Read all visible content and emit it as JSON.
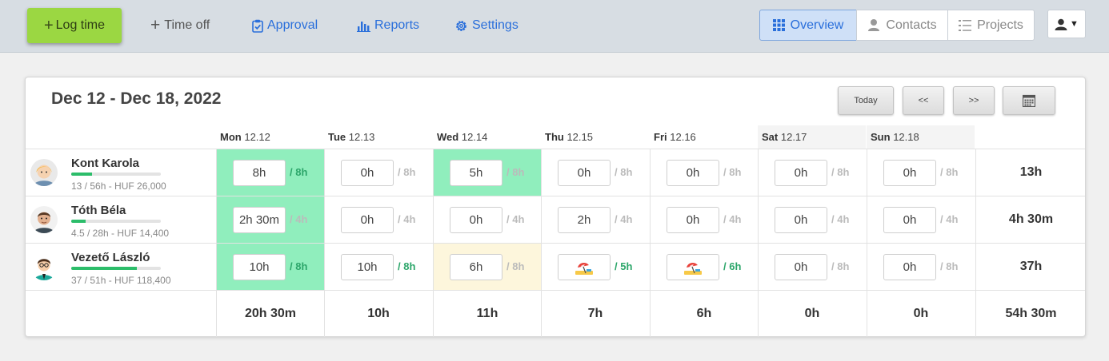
{
  "toolbar": {
    "log_time": "Log time",
    "time_off": "Time off",
    "approval": "Approval",
    "reports": "Reports",
    "settings": "Settings",
    "overview": "Overview",
    "contacts": "Contacts",
    "projects": "Projects"
  },
  "week": {
    "title": "Dec 12 - Dec 18, 2022",
    "today_label": "Today",
    "prev_label": "<<",
    "next_label": ">>",
    "days": [
      {
        "name": "Mon",
        "date": "12.12"
      },
      {
        "name": "Tue",
        "date": "12.13"
      },
      {
        "name": "Wed",
        "date": "12.14"
      },
      {
        "name": "Thu",
        "date": "12.15"
      },
      {
        "name": "Fri",
        "date": "12.16"
      },
      {
        "name": "Sat",
        "date": "12.17"
      },
      {
        "name": "Sun",
        "date": "12.18"
      }
    ]
  },
  "people": [
    {
      "name": "Kont Karola",
      "stats": "13 / 56h - HUF 26,000",
      "progress": 0.23,
      "cells": [
        {
          "value": "8h",
          "expected": "/ 8h",
          "state": "green",
          "ok": true
        },
        {
          "value": "0h",
          "expected": "/ 8h",
          "state": "none",
          "ok": false
        },
        {
          "value": "5h",
          "expected": "/ 8h",
          "state": "green",
          "ok": false
        },
        {
          "value": "0h",
          "expected": "/ 8h",
          "state": "none",
          "ok": false
        },
        {
          "value": "0h",
          "expected": "/ 8h",
          "state": "none",
          "ok": false
        },
        {
          "value": "0h",
          "expected": "/ 8h",
          "state": "none",
          "ok": false
        },
        {
          "value": "0h",
          "expected": "/ 8h",
          "state": "none",
          "ok": false
        }
      ],
      "total": "13h"
    },
    {
      "name": "Tóth Béla",
      "stats": "4.5 / 28h - HUF 14,400",
      "progress": 0.16,
      "cells": [
        {
          "value": "2h 30m",
          "expected": "/ 4h",
          "state": "green",
          "ok": false
        },
        {
          "value": "0h",
          "expected": "/ 4h",
          "state": "none",
          "ok": false
        },
        {
          "value": "0h",
          "expected": "/ 4h",
          "state": "none",
          "ok": false
        },
        {
          "value": "2h",
          "expected": "/ 4h",
          "state": "none",
          "ok": false
        },
        {
          "value": "0h",
          "expected": "/ 4h",
          "state": "none",
          "ok": false
        },
        {
          "value": "0h",
          "expected": "/ 4h",
          "state": "none",
          "ok": false
        },
        {
          "value": "0h",
          "expected": "/ 4h",
          "state": "none",
          "ok": false
        }
      ],
      "total": "4h 30m"
    },
    {
      "name": "Vezető László",
      "stats": "37 / 51h - HUF 118,400",
      "progress": 0.73,
      "cells": [
        {
          "value": "10h",
          "expected": "/ 8h",
          "state": "green",
          "ok": true
        },
        {
          "value": "10h",
          "expected": "/ 8h",
          "state": "none",
          "ok": true
        },
        {
          "value": "6h",
          "expected": "/ 8h",
          "state": "yellow",
          "ok": false
        },
        {
          "value": "",
          "expected": "/ 5h",
          "state": "timeoff",
          "ok": true
        },
        {
          "value": "",
          "expected": "/ 6h",
          "state": "timeoff",
          "ok": true
        },
        {
          "value": "0h",
          "expected": "/ 8h",
          "state": "none",
          "ok": false
        },
        {
          "value": "0h",
          "expected": "/ 8h",
          "state": "none",
          "ok": false
        }
      ],
      "total": "37h"
    }
  ],
  "totals": {
    "days": [
      "20h 30m",
      "10h",
      "11h",
      "7h",
      "6h",
      "0h",
      "0h"
    ],
    "grand": "54h 30m"
  }
}
